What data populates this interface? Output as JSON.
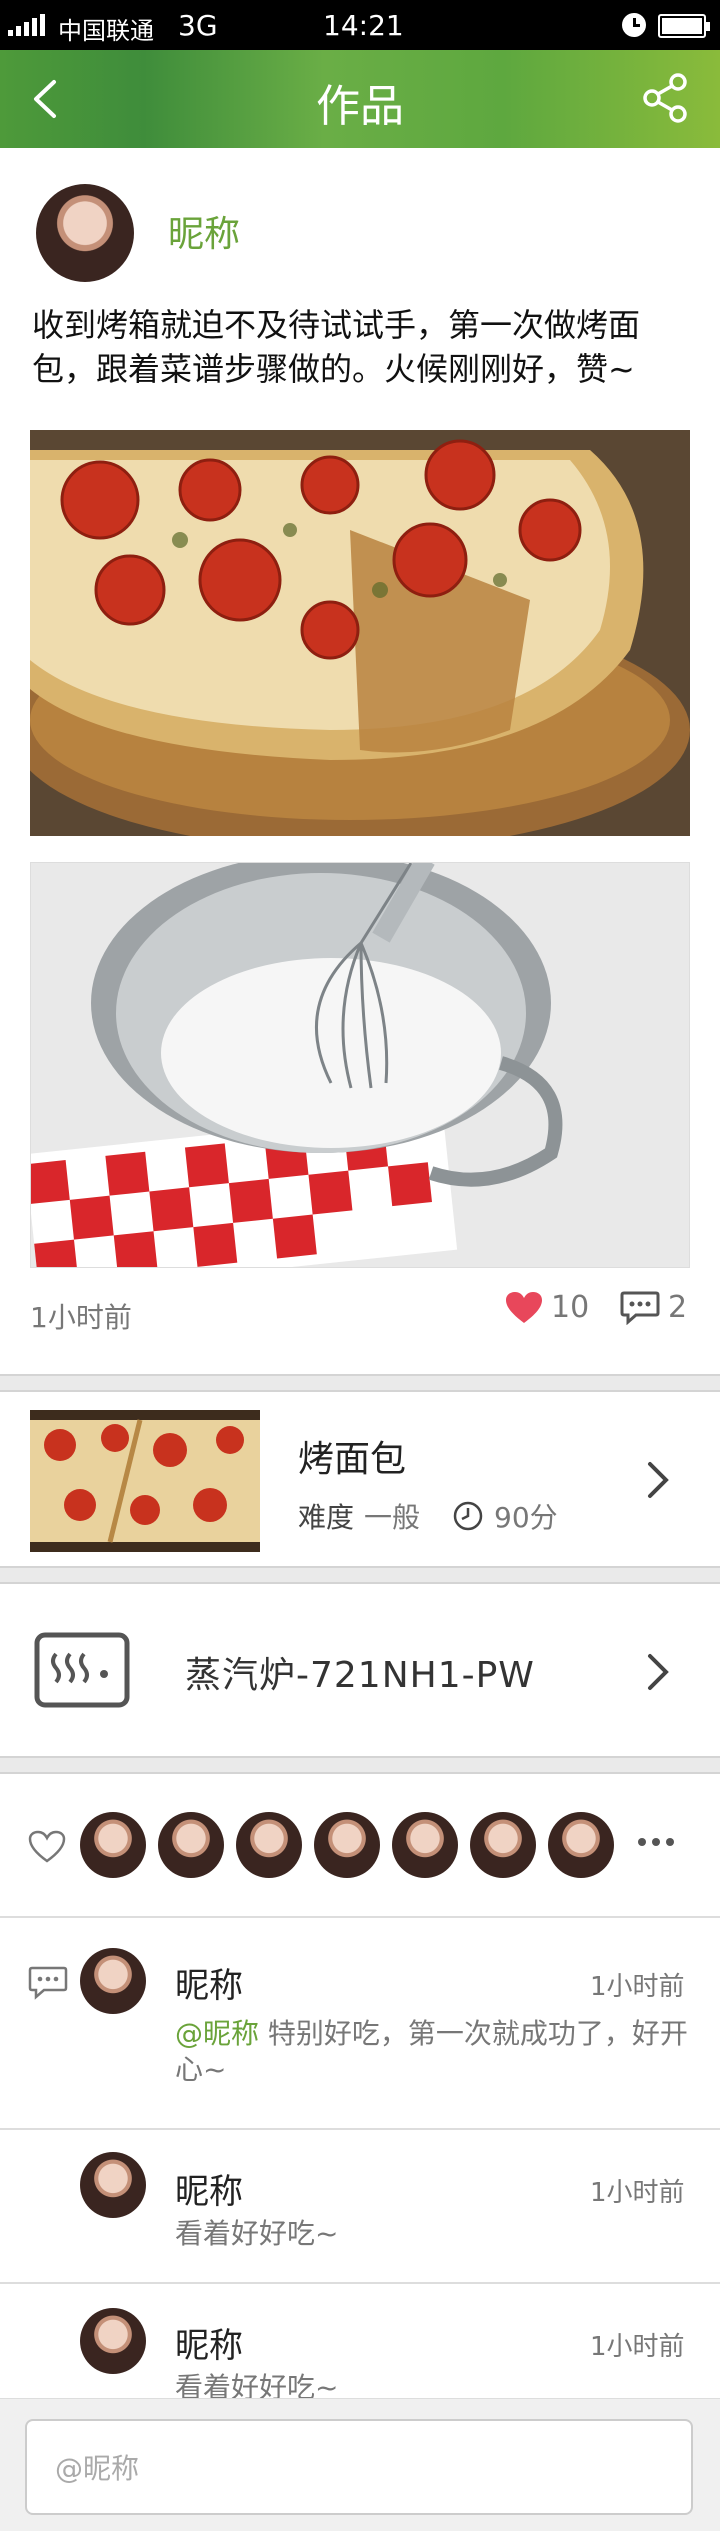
{
  "status_bar": {
    "carrier": "中国联通",
    "network": "3G",
    "time": "14:21"
  },
  "nav": {
    "title": "作品",
    "back_icon": "chevron-left-icon",
    "share_icon": "share-icon"
  },
  "post": {
    "author": "昵称",
    "text": "收到烤箱就迫不及待试试手，第一次做烤面包，跟着菜谱步骤做的。火候刚刚好，赞~",
    "images": [
      "pizza-photo",
      "whisk-bowl-photo"
    ],
    "time": "1小时前",
    "likes": "10",
    "comments": "2"
  },
  "recipe": {
    "name": "烤面包",
    "difficulty_label": "难度",
    "difficulty": "一般",
    "duration": "90分"
  },
  "device": {
    "name": "蒸汽炉-721NH1-PW"
  },
  "fans": {
    "count_shown": 7
  },
  "comments": [
    {
      "name": "昵称",
      "time": "1小时前",
      "mention": "@昵称",
      "text": " 特别好吃，第一次就成功了，好开心~"
    },
    {
      "name": "昵称",
      "time": "1小时前",
      "text": "看着好好吃~"
    },
    {
      "name": "昵称",
      "time": "1小时前",
      "text": "看着好好吃~"
    }
  ],
  "input": {
    "placeholder": "@昵称"
  },
  "colors": {
    "accent": "#6aa33a",
    "like": "#e8475b",
    "nav": "#5ea83f"
  }
}
